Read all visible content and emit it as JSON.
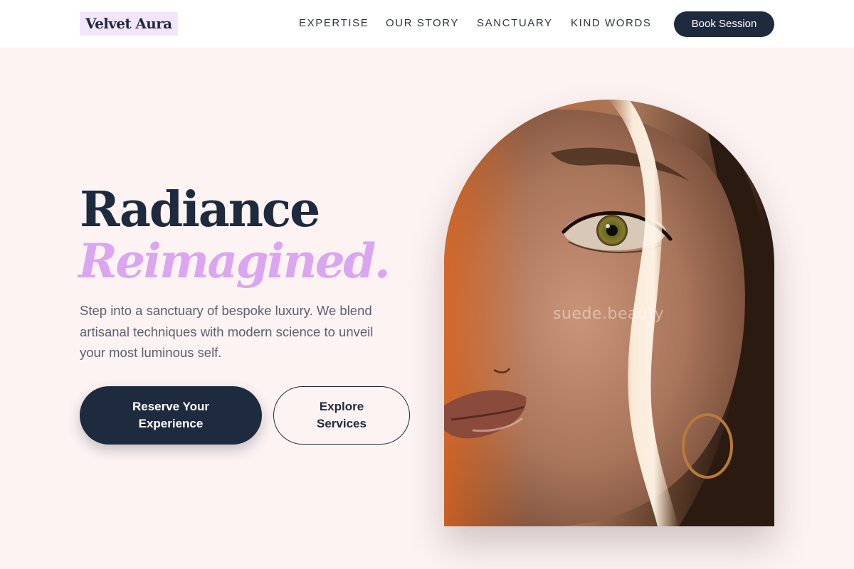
{
  "brand": {
    "name": "Velvet Aura"
  },
  "nav": {
    "items": [
      {
        "label": "EXPERTISE"
      },
      {
        "label": "OUR STORY"
      },
      {
        "label": "SANCTUARY"
      },
      {
        "label": "KIND WORDS"
      }
    ],
    "cta_label": "Book Session"
  },
  "hero": {
    "title_line1": "Radiance",
    "title_line2": "Reimagined.",
    "description": "Step into a sanctuary of bespoke luxury. We blend artisanal techniques with modern science to unveil your most luminous self.",
    "primary_button": "Reserve Your Experience",
    "secondary_button": "Explore Services",
    "image_watermark": "suede.beauty"
  },
  "colors": {
    "navy": "#1e2a3d",
    "lavender": "#dba6f1",
    "blush_background": "#fdf3f3",
    "logo_highlight": "#f3e6fb"
  }
}
